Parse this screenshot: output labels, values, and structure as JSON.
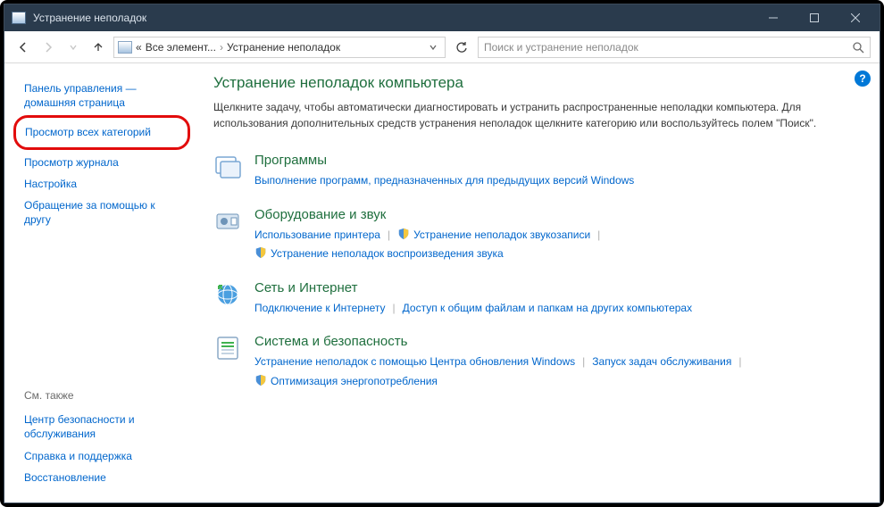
{
  "window": {
    "title": "Устранение неполадок"
  },
  "breadcrumb": {
    "prefix": "«",
    "parent": "Все элемент...",
    "current": "Устранение неполадок"
  },
  "search": {
    "placeholder": "Поиск и устранение неполадок"
  },
  "sidebar": {
    "items": [
      "Панель управления — домашняя страница",
      "Просмотр всех категорий",
      "Просмотр журнала",
      "Настройка",
      "Обращение за помощью к другу"
    ],
    "seealso_heading": "См. также",
    "seealso": [
      "Центр безопасности и обслуживания",
      "Справка и поддержка",
      "Восстановление"
    ]
  },
  "main": {
    "heading": "Устранение неполадок компьютера",
    "description": "Щелкните задачу, чтобы автоматически диагностировать и устранить распространенные неполадки компьютера. Для использования дополнительных средств устранения неполадок щелкните категорию или воспользуйтесь полем \"Поиск\"."
  },
  "categories": [
    {
      "id": "programs",
      "title": "Программы",
      "links": [
        {
          "text": "Выполнение программ, предназначенных для предыдущих версий Windows",
          "shield": false
        }
      ]
    },
    {
      "id": "hardware",
      "title": "Оборудование и звук",
      "links": [
        {
          "text": "Использование принтера",
          "shield": false
        },
        {
          "text": "Устранение неполадок звукозаписи",
          "shield": true
        },
        {
          "text": "Устранение неполадок воспроизведения звука",
          "shield": true
        }
      ]
    },
    {
      "id": "network",
      "title": "Сеть и Интернет",
      "links": [
        {
          "text": "Подключение к Интернету",
          "shield": false
        },
        {
          "text": "Доступ к общим файлам и папкам на других компьютерах",
          "shield": false
        }
      ]
    },
    {
      "id": "system",
      "title": "Система и безопасность",
      "links": [
        {
          "text": "Устранение неполадок с помощью Центра обновления Windows",
          "shield": false
        },
        {
          "text": "Запуск задач обслуживания",
          "shield": false
        },
        {
          "text": "Оптимизация энергопотребления",
          "shield": true
        }
      ]
    }
  ]
}
